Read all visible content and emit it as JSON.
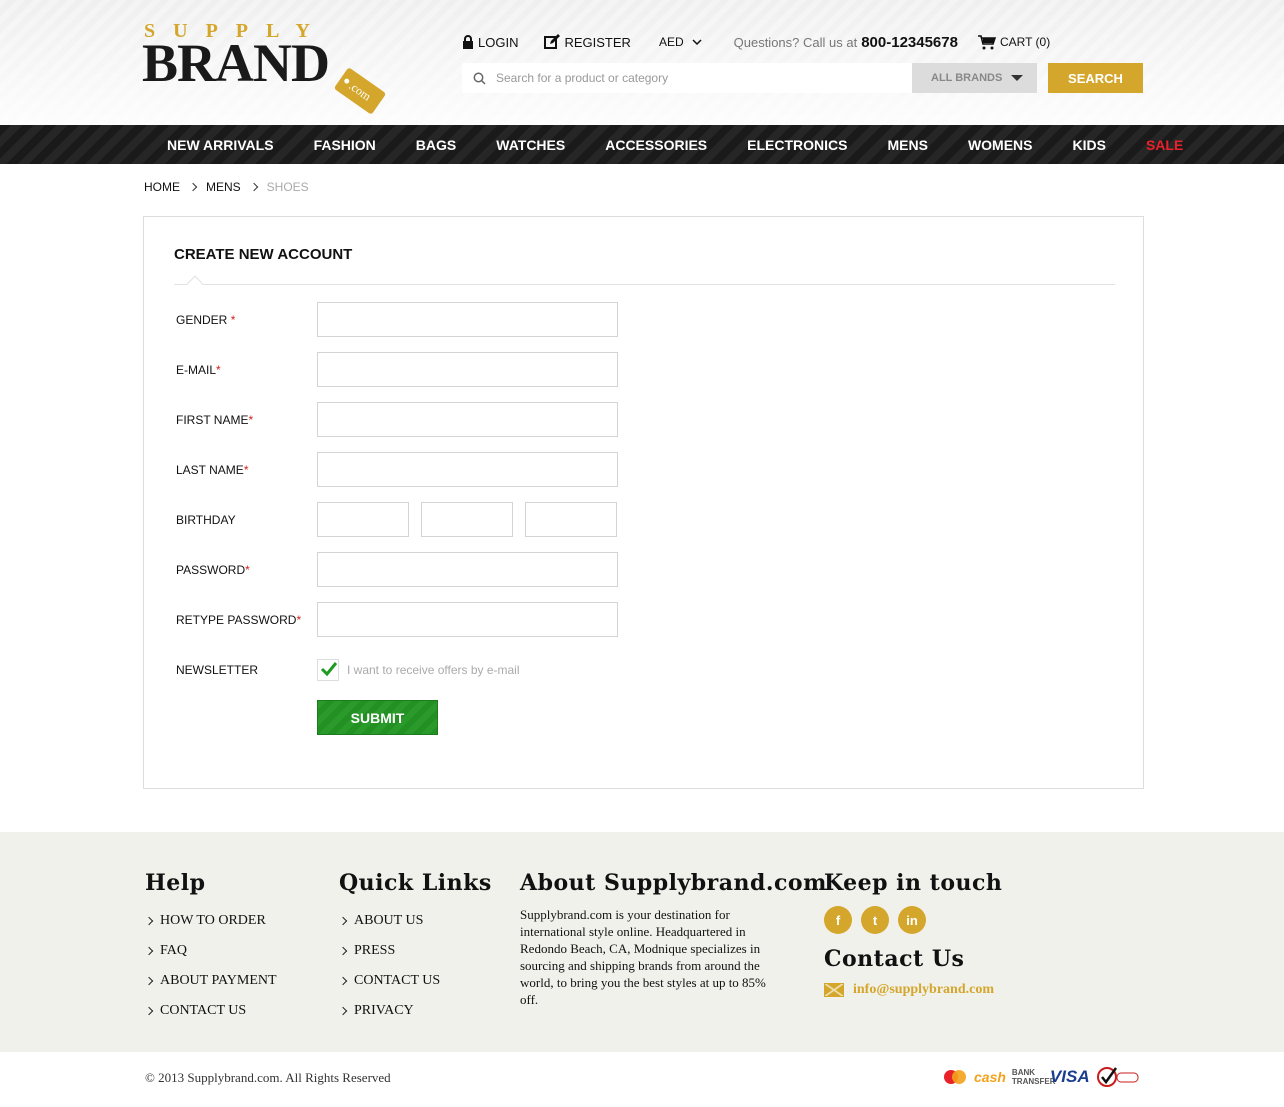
{
  "logo": {
    "top": "SUPPLY",
    "main": "BRAND",
    "tag": ".com"
  },
  "topbar": {
    "login": "LOGIN",
    "register": "REGISTER",
    "currency": "AED",
    "question": "Questions? Call us at",
    "phone": "800-12345678",
    "cart": "CART (0)"
  },
  "search": {
    "placeholder": "Search for a product or category",
    "brands": "ALL BRANDS",
    "button": "SEARCH"
  },
  "nav": [
    "NEW ARRIVALS",
    "FASHION",
    "BAGS",
    "WATCHES",
    "ACCESSORIES",
    "ELECTRONICS",
    "MENS",
    "WOMENS",
    "KIDS",
    "SALE"
  ],
  "breadcrumb": {
    "home": "HOME",
    "mens": "MENS",
    "current": "SHOES"
  },
  "form": {
    "title": "CREATE NEW ACCOUNT",
    "required_mark": "*",
    "fields": {
      "gender": "GENDER",
      "email": "E-MAIL",
      "first_name": "FIRST NAME",
      "last_name": "LAST NAME",
      "birthday": "BIRTHDAY",
      "password": "PASSWORD",
      "retype_password": "RETYPE PASSWORD",
      "newsletter": "NEWSLETTER"
    },
    "newsletter_text": "I want to receive offers by e-mail",
    "newsletter_checked": true,
    "submit": "SUBMIT"
  },
  "footer": {
    "help": {
      "title": "Help",
      "links": [
        "HOW TO ORDER",
        "FAQ",
        "ABOUT PAYMENT",
        "CONTACT US"
      ]
    },
    "quick": {
      "title": "Quick Links",
      "links": [
        "ABOUT US",
        "PRESS",
        "CONTACT US",
        "PRIVACY"
      ]
    },
    "about": {
      "title": "About Supplybrand.com",
      "text": "Supplybrand.com is your destination for international style online. Headquartered in Redondo Beach, CA, Modnique specializes in sourcing and shipping brands from around the world, to bring you the best styles at up to 85% off."
    },
    "touch": {
      "title": "Keep in touch",
      "social": [
        "f",
        "t",
        "in"
      ],
      "contact_title": "Contact Us",
      "email": "info@supplybrand.com"
    }
  },
  "bottom": {
    "copyright": "© 2013 Supplybrand.com. All Rights Reserved",
    "payments": [
      "cash",
      "BANK TRANSFER",
      "VISA"
    ]
  },
  "colors": {
    "gold": "#d4a62b",
    "sale": "#e8222b",
    "green": "#2a9a2a",
    "dark": "#1a1a1a"
  }
}
